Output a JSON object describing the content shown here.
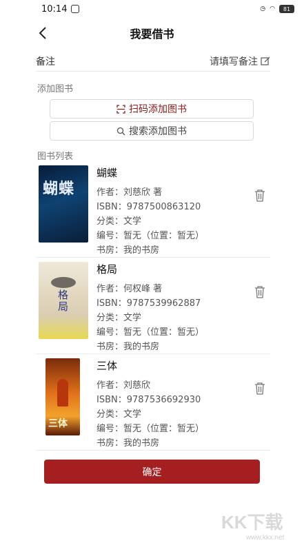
{
  "status_bar": {
    "time": "10:14",
    "battery": "81"
  },
  "header": {
    "title": "我要借书"
  },
  "remark": {
    "label": "备注",
    "placeholder": "请填写备注"
  },
  "add_section": {
    "label": "添加图书",
    "scan_button": "扫码添加图书",
    "search_button": "搜索添加图书"
  },
  "list_section": {
    "label": "图书列表"
  },
  "books": [
    {
      "title": "蝴蝶",
      "author": "作者：刘慈欣 著",
      "isbn": "ISBN：9787500863120",
      "category": "分类：文学",
      "code": "编号：暂无（位置：暂无）",
      "library": "书房：我的书房",
      "cover_text": "蝴蝶",
      "cover_color": "#0f4272"
    },
    {
      "title": "格局",
      "author": "作者：何权峰 著",
      "isbn": "ISBN：9787539962887",
      "category": "分类：文学",
      "code": "编号：暂无（位置：暂无）",
      "library": "书房：我的书房",
      "cover_text": "格局",
      "cover_color": "#e6d850"
    },
    {
      "title": "三体",
      "author": "作者：刘慈欣",
      "isbn": "ISBN：9787536692930",
      "category": "分类：文学",
      "code": "编号：暂无（位置：暂无）",
      "library": "书房：我的书房",
      "cover_text": "三体",
      "cover_color": "#e0701a"
    }
  ],
  "confirm_button": "确定",
  "watermark": {
    "text": "KK下载",
    "url": "www.kkx.net"
  },
  "colors": {
    "accent": "#a51f20",
    "scan_text": "#8b1a1a"
  },
  "icons": [
    "back-arrow-icon",
    "edit-icon",
    "scan-icon",
    "search-icon",
    "trash-icon"
  ]
}
